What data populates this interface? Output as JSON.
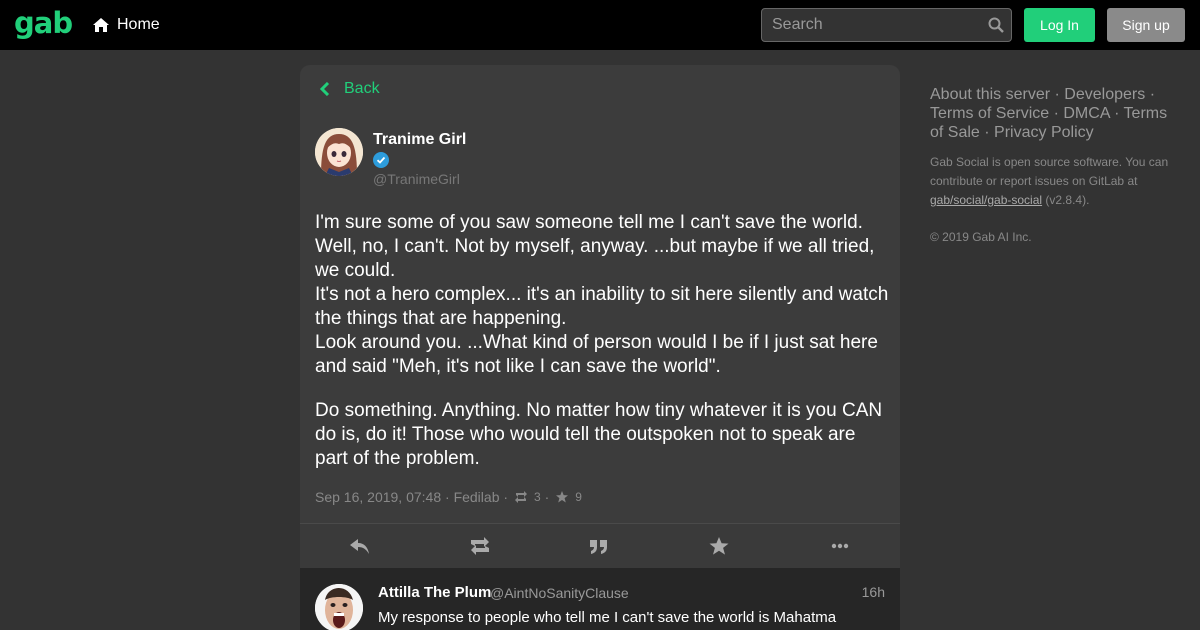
{
  "topbar": {
    "logo": "gab",
    "home_label": "Home",
    "search_placeholder": "Search",
    "login_label": "Log In",
    "signup_label": "Sign up"
  },
  "column": {
    "back_label": "Back",
    "post": {
      "display_name": "Tranime Girl",
      "handle": "@TranimeGirl",
      "verified": true,
      "paragraph_1": "I'm sure some of you saw someone tell me I can't save the world. Well, no, I can't. Not by myself, anyway. ...but maybe if we all tried, we could.\nIt's not a hero complex... it's an inability to sit here silently and watch the things that are happening.\nLook around you. ...What kind of person would I be if I just sat here and said \"Meh, it's not like I can save the world\".",
      "paragraph_2": "Do something. Anything. No matter how tiny whatever it is you CAN do is, do it! Those who would tell the outspoken not to speak are part of the problem.",
      "date": "Sep 16, 2019, 07:48",
      "app": "Fedilab",
      "sep": "·",
      "reposts": "3",
      "favourites": "9"
    },
    "actions": [
      "reply-icon",
      "repost-icon",
      "quote-icon",
      "favourite-icon",
      "more-icon"
    ],
    "reply": {
      "display_name": "Attilla The Plum",
      "handle": "@AintNoSanityClause",
      "time": "16h",
      "text": "My response to people who tell me I can't save the world is Mahatma"
    }
  },
  "sidebar": {
    "link_about": "About this server",
    "link_developers": "Developers",
    "link_tos": "Terms of Service",
    "link_dmca": "DMCA",
    "link_tos_sale": "Terms of Sale",
    "link_privacy": "Privacy Policy",
    "dot": "·",
    "info_text": "Gab Social is open source software. You can contribute or report issues on GitLab at",
    "repo_link": "gab/social/gab-social",
    "version": "(v2.8.4).",
    "copyright": "© 2019 Gab AI Inc."
  },
  "colors": {
    "accent": "#21cf7a",
    "background": "#333333",
    "topbar": "#000000",
    "panel": "#3c3c3c",
    "verified": "#2d9cdb"
  }
}
